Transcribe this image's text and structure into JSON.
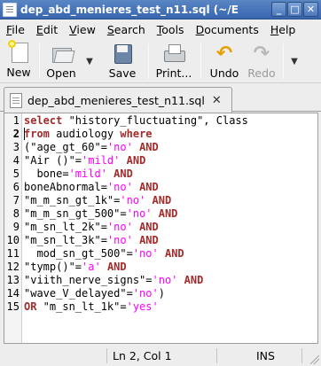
{
  "window": {
    "title": "dep_abd_menieres_test_n11.sql (~/E",
    "controls": [
      "_",
      "□",
      "✕"
    ]
  },
  "menu": [
    {
      "label": "File",
      "mnemonic": "F",
      "rest": "ile"
    },
    {
      "label": "Edit",
      "mnemonic": "E",
      "rest": "dit"
    },
    {
      "label": "View",
      "mnemonic": "V",
      "rest": "iew"
    },
    {
      "label": "Search",
      "mnemonic": "S",
      "rest": "earch"
    },
    {
      "label": "Tools",
      "mnemonic": "T",
      "rest": "ools"
    },
    {
      "label": "Documents",
      "mnemonic": "D",
      "rest": "ocuments"
    },
    {
      "label": "Help",
      "mnemonic": "H",
      "rest": "elp"
    }
  ],
  "toolbar": {
    "new_label": "New",
    "open_label": "Open",
    "save_label": "Save",
    "print_label": "Print...",
    "undo_label": "Undo",
    "redo_label": "Redo"
  },
  "tab": {
    "label": "dep_abd_menieres_test_n11.sql",
    "close": "✕"
  },
  "editor": {
    "current_line": 2,
    "lines": [
      [
        {
          "t": "select",
          "c": "kw"
        },
        {
          "t": " \"history_fluctuating\", Class",
          "c": ""
        }
      ],
      [
        {
          "t": "from",
          "c": "kw"
        },
        {
          "t": " audiology ",
          "c": ""
        },
        {
          "t": "where",
          "c": "kw"
        }
      ],
      [
        {
          "t": "(\"age_gt_60\"=",
          "c": ""
        },
        {
          "t": "'no'",
          "c": "str"
        },
        {
          "t": " ",
          "c": ""
        },
        {
          "t": "AND",
          "c": "kw"
        }
      ],
      [
        {
          "t": "\"Air ()\"=",
          "c": ""
        },
        {
          "t": "'mild'",
          "c": "str"
        },
        {
          "t": " ",
          "c": ""
        },
        {
          "t": "AND",
          "c": "kw"
        }
      ],
      [
        {
          "t": "  bone=",
          "c": ""
        },
        {
          "t": "'mild'",
          "c": "str"
        },
        {
          "t": " ",
          "c": ""
        },
        {
          "t": "AND",
          "c": "kw"
        }
      ],
      [
        {
          "t": "boneAbnormal=",
          "c": ""
        },
        {
          "t": "'no'",
          "c": "str"
        },
        {
          "t": " ",
          "c": ""
        },
        {
          "t": "AND",
          "c": "kw"
        }
      ],
      [
        {
          "t": "\"m_m_sn_gt_1k\"=",
          "c": ""
        },
        {
          "t": "'no'",
          "c": "str"
        },
        {
          "t": " ",
          "c": ""
        },
        {
          "t": "AND",
          "c": "kw"
        }
      ],
      [
        {
          "t": "\"m_m_sn_gt_500\"=",
          "c": ""
        },
        {
          "t": "'no'",
          "c": "str"
        },
        {
          "t": " ",
          "c": ""
        },
        {
          "t": "AND",
          "c": "kw"
        }
      ],
      [
        {
          "t": "\"m_sn_lt_2k\"=",
          "c": ""
        },
        {
          "t": "'no'",
          "c": "str"
        },
        {
          "t": " ",
          "c": ""
        },
        {
          "t": "AND",
          "c": "kw"
        }
      ],
      [
        {
          "t": "\"m_sn_lt_3k\"=",
          "c": ""
        },
        {
          "t": "'no'",
          "c": "str"
        },
        {
          "t": " ",
          "c": ""
        },
        {
          "t": "AND",
          "c": "kw"
        }
      ],
      [
        {
          "t": "  mod_sn_gt_500\"=",
          "c": ""
        },
        {
          "t": "'no'",
          "c": "str"
        },
        {
          "t": " ",
          "c": ""
        },
        {
          "t": "AND",
          "c": "kw"
        }
      ],
      [
        {
          "t": "\"tymp()\"=",
          "c": ""
        },
        {
          "t": "'a'",
          "c": "str"
        },
        {
          "t": " ",
          "c": ""
        },
        {
          "t": "AND",
          "c": "kw"
        }
      ],
      [
        {
          "t": "\"viith_nerve_signs\"=",
          "c": ""
        },
        {
          "t": "'no'",
          "c": "str"
        },
        {
          "t": " ",
          "c": ""
        },
        {
          "t": "AND",
          "c": "kw"
        }
      ],
      [
        {
          "t": "\"wave_V_delayed\"=",
          "c": ""
        },
        {
          "t": "'no'",
          "c": "str"
        },
        {
          "t": ")",
          "c": ""
        }
      ],
      [
        {
          "t": "OR",
          "c": "kw"
        },
        {
          "t": " \"m_sn_lt_1k\"=",
          "c": ""
        },
        {
          "t": "'yes'",
          "c": "str"
        }
      ]
    ]
  },
  "status": {
    "position": "Ln 2, Col 1",
    "mode": "INS"
  }
}
